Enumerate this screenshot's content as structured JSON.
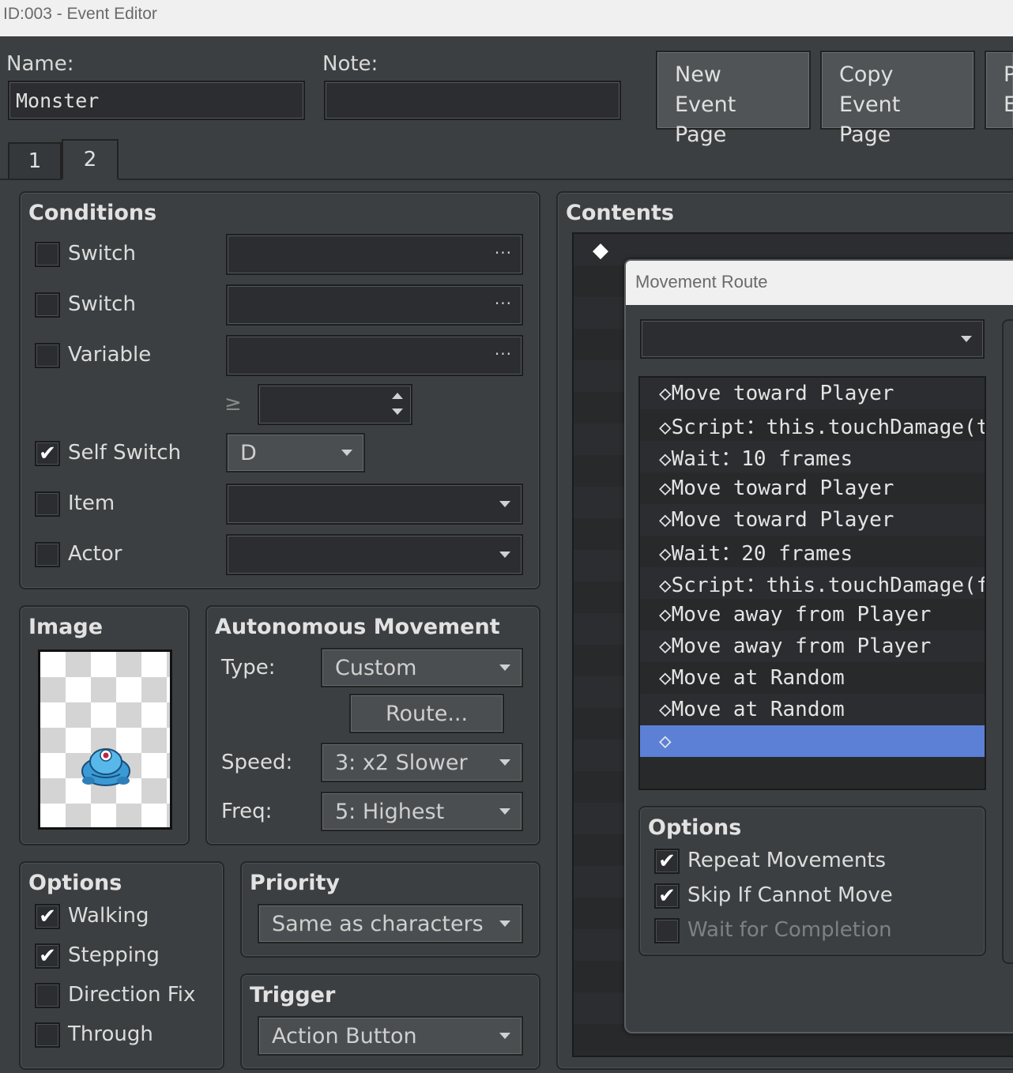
{
  "window": {
    "title": "ID:003 - Event Editor"
  },
  "header": {
    "name_label": "Name:",
    "name_value": "Monster",
    "note_label": "Note:",
    "note_value": "",
    "new_page_line1": "New",
    "new_page_line2": "Event Page",
    "copy_page_line1": "Copy",
    "copy_page_line2": "Event Page",
    "paste_page_line1": "P",
    "paste_page_line2": "E"
  },
  "tabs": [
    {
      "label": "1"
    },
    {
      "label": "2"
    }
  ],
  "conditions": {
    "title": "Conditions",
    "switch1": {
      "label": "Switch",
      "checked": false,
      "value": ""
    },
    "switch2": {
      "label": "Switch",
      "checked": false,
      "value": ""
    },
    "variable": {
      "label": "Variable",
      "checked": false,
      "value": ""
    },
    "comparator": "≥",
    "self_switch": {
      "label": "Self Switch",
      "checked": true,
      "value": "D"
    },
    "item": {
      "label": "Item",
      "checked": false,
      "value": ""
    },
    "actor": {
      "label": "Actor",
      "checked": false,
      "value": ""
    },
    "check_glyph": "✔"
  },
  "image": {
    "title": "Image"
  },
  "autonomous": {
    "title": "Autonomous Movement",
    "type_label": "Type:",
    "type_value": "Custom",
    "route_button": "Route...",
    "speed_label": "Speed:",
    "speed_value": "3: x2 Slower",
    "freq_label": "Freq:",
    "freq_value": "5: Highest"
  },
  "options": {
    "title": "Options",
    "walking": {
      "label": "Walking",
      "checked": true
    },
    "stepping": {
      "label": "Stepping",
      "checked": true
    },
    "direction_fix": {
      "label": "Direction Fix",
      "checked": false
    },
    "through": {
      "label": "Through",
      "checked": false
    }
  },
  "priority": {
    "title": "Priority",
    "value": "Same as characters"
  },
  "trigger": {
    "title": "Trigger",
    "value": "Action Button"
  },
  "contents": {
    "title": "Contents",
    "first_row_marker": "◆"
  },
  "movement_route": {
    "title": "Movement Route",
    "target_value": "",
    "commands": [
      "◇Move toward Player",
      "◇Script：this.touchDamage(t…",
      "◇Wait：10 frames",
      "◇Move toward Player",
      "◇Move toward Player",
      "◇Wait：20 frames",
      "◇Script：this.touchDamage(f…",
      "◇Move away from Player",
      "◇Move away from Player",
      "◇Move at Random",
      "◇Move at Random",
      "◇"
    ],
    "selected_index": 11,
    "options_title": "Options",
    "repeat": {
      "label": "Repeat Movements",
      "checked": true
    },
    "skip": {
      "label": "Skip If Cannot Move",
      "checked": true
    },
    "wait": {
      "label": "Wait for Completion",
      "checked": false
    }
  },
  "colors": {
    "selection": "#5b80d6",
    "panel": "#3c3f41",
    "field": "#2b2d30"
  }
}
